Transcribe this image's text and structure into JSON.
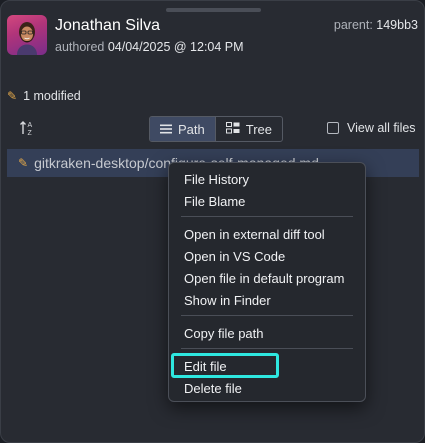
{
  "commit": {
    "author_name": "Jonathan Silva",
    "authored_label": "authored",
    "authored_date": "04/04/2025 @ 12:04 PM",
    "parent_label": "parent:",
    "parent_sha": "149bb3"
  },
  "changes": {
    "modified_label": "1 modified"
  },
  "toolbar": {
    "path_label": "Path",
    "tree_label": "Tree",
    "view_all_label": "View all files",
    "view_all_checked": false,
    "active_view": "Path"
  },
  "file": {
    "path": "gitkraken-desktop/configure-self-managed.md"
  },
  "context_menu": {
    "items": [
      "File History",
      "File Blame",
      "Open in external diff tool",
      "Open in VS Code",
      "Open file in default program",
      "Show in Finder",
      "Copy file path",
      "Edit file",
      "Delete file"
    ],
    "highlighted_item": "Edit file"
  },
  "colors": {
    "highlight": "#2ee7e0",
    "selected_row": "#343f57",
    "modified_icon": "#e3a84a"
  }
}
